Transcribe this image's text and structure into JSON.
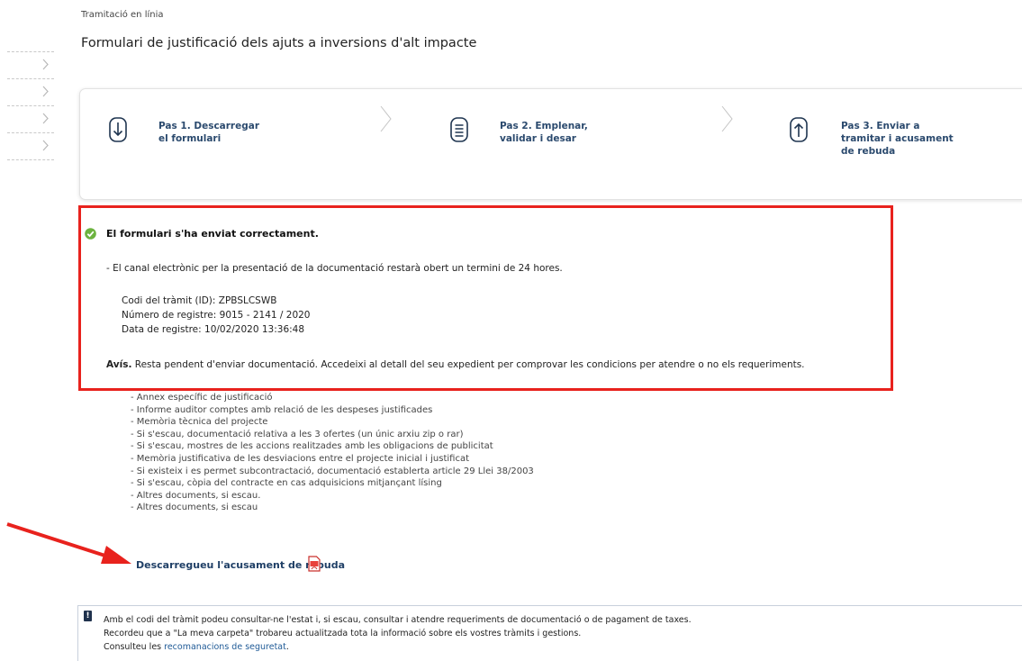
{
  "breadcrumb": "Tramitació en línia",
  "page_title": "Formulari de justificació dels ajuts a inversions d'alt impacte",
  "sidenav": {
    "items": 4
  },
  "steps": [
    {
      "icon": "download-icon",
      "line1": "Pas 1. Descarregar",
      "line2": "el formulari",
      "line3": ""
    },
    {
      "icon": "document-icon",
      "line1": "Pas 2. Emplenar,",
      "line2": "validar i desar",
      "line3": ""
    },
    {
      "icon": "upload-icon",
      "line1": "Pas 3. Enviar a",
      "line2": "tramitar i acusament",
      "line3": "de rebuda"
    }
  ],
  "result": {
    "title": "El formulari s'ha enviat correctament.",
    "channel_note": "- El canal electrònic per la presentació de la documentació restarà obert un termini de 24 hores.",
    "code_line": "Codi del tràmit (ID): ZPBSLCSWB",
    "registry_line": "Número de registre: 9015 - 2141 / 2020",
    "date_line": "Data de registre: 10/02/2020 13:36:48",
    "notice_bold": "Avís.",
    "notice_text": " Resta pendent d'enviar documentació. Accedeixi al detall del seu expedient per comprovar les condicions per atendre o no els requeriments."
  },
  "documents": [
    "- Annex específic de justificació",
    "- Informe auditor comptes amb relació de les despeses justificades",
    "- Memòria tècnica del projecte",
    "- Si s'escau, documentació relativa a les 3 ofertes (un únic arxiu zip o rar)",
    "- Si s'escau, mostres de les accions realitzades amb les obligacions de publicitat",
    "- Memòria justificativa de les desviacions entre el projecte inicial i justificat",
    "- Si existeix i es permet subcontractació, documentació establerta article 29 Llei 38/2003",
    "- Si s'escau, còpia del contracte en cas adquisicions mitjançant lísing",
    "- Altres documents, si escau.",
    "- Altres documents, si escau"
  ],
  "download_link": "Descarregueu l'acusament de rebuda",
  "info": {
    "line1": "Amb el codi del tràmit podeu consultar-ne l'estat i, si escau, consultar i atendre requeriments de documentació o de pagament de taxes.",
    "line2": "Recordeu que a \"La meva carpeta\" trobareu actualitzada tota la informació sobre els vostres tràmits i gestions.",
    "line3_prefix": "Consulteu les ",
    "line3_link": "recomanacions de seguretat",
    "line3_suffix": "."
  },
  "colors": {
    "highlight_border": "#e8221d",
    "step_text": "#2b4a6e",
    "link": "#1f5a96",
    "success": "#6cb33f"
  }
}
